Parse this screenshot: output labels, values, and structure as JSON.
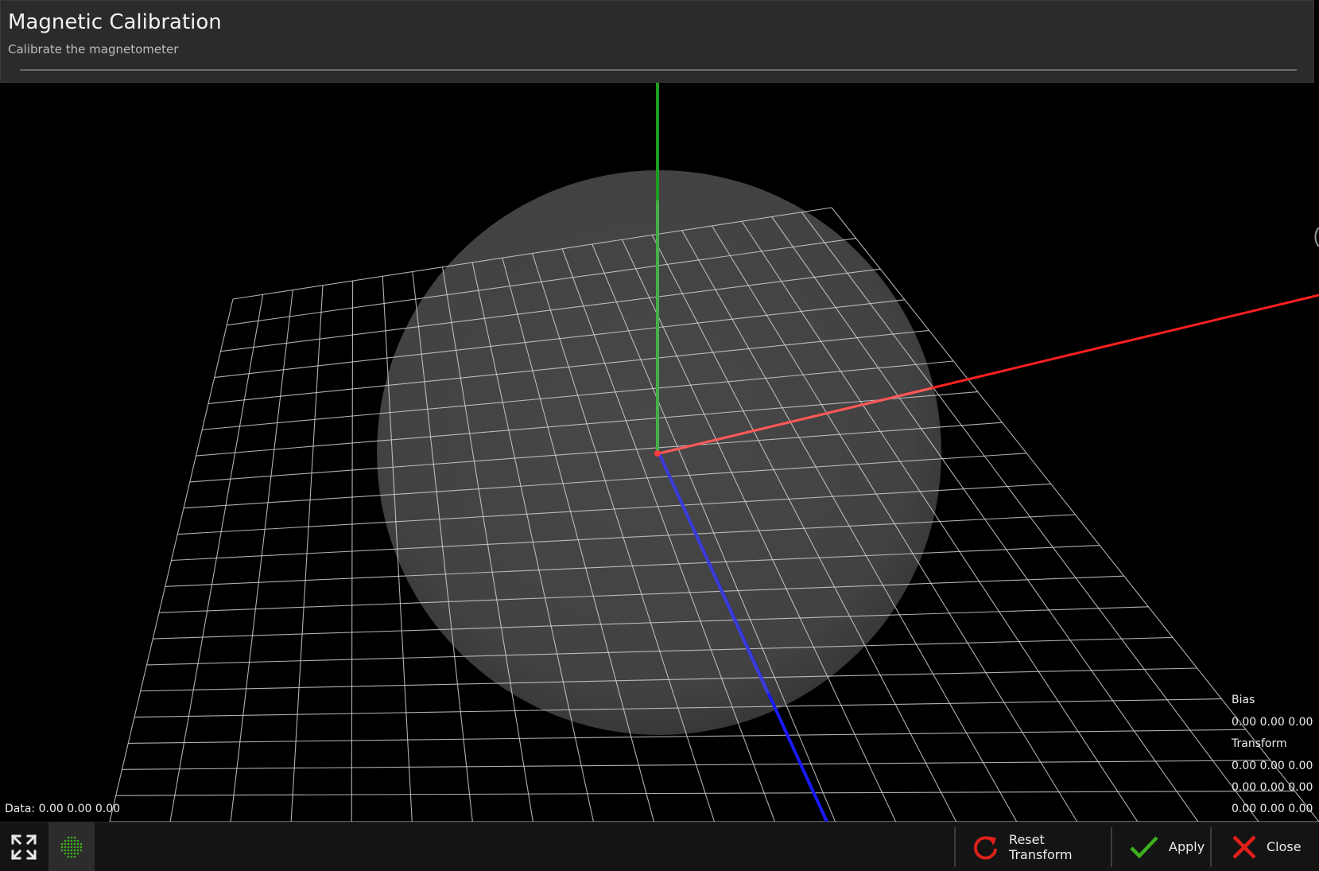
{
  "header": {
    "title": "Magnetic Calibration",
    "subtitle": "Calibrate the magnetometer"
  },
  "viewport": {
    "data_readout": "Data: 0.00 0.00 0.00",
    "bias_label": "Bias",
    "bias_value": "0.00 0.00 0.00",
    "transform_label": "Transform",
    "transform_rows": [
      "0.00 0.00 0.00",
      "0.00 0.00 0.00",
      "0.00 0.00 0.00"
    ],
    "axis_colors": {
      "x": "#ff2020",
      "y": "#19a319",
      "z": "#1a1aff"
    },
    "sphere_color": "#484848",
    "grid_color": "#cfcfcf"
  },
  "toolbar": {
    "fullscreen_icon": "expand-arrows-icon",
    "points_icon": "dot-grid-icon",
    "reset_label": "Reset Transform",
    "reset_icon": "refresh-icon",
    "apply_label": "Apply",
    "apply_icon": "checkmark-icon",
    "close_label": "Close",
    "close_icon": "close-x-icon",
    "icon_colors": {
      "reset": "#e0201a",
      "apply": "#3fae1f",
      "close": "#e0201a",
      "points": "#3fae1f"
    }
  }
}
